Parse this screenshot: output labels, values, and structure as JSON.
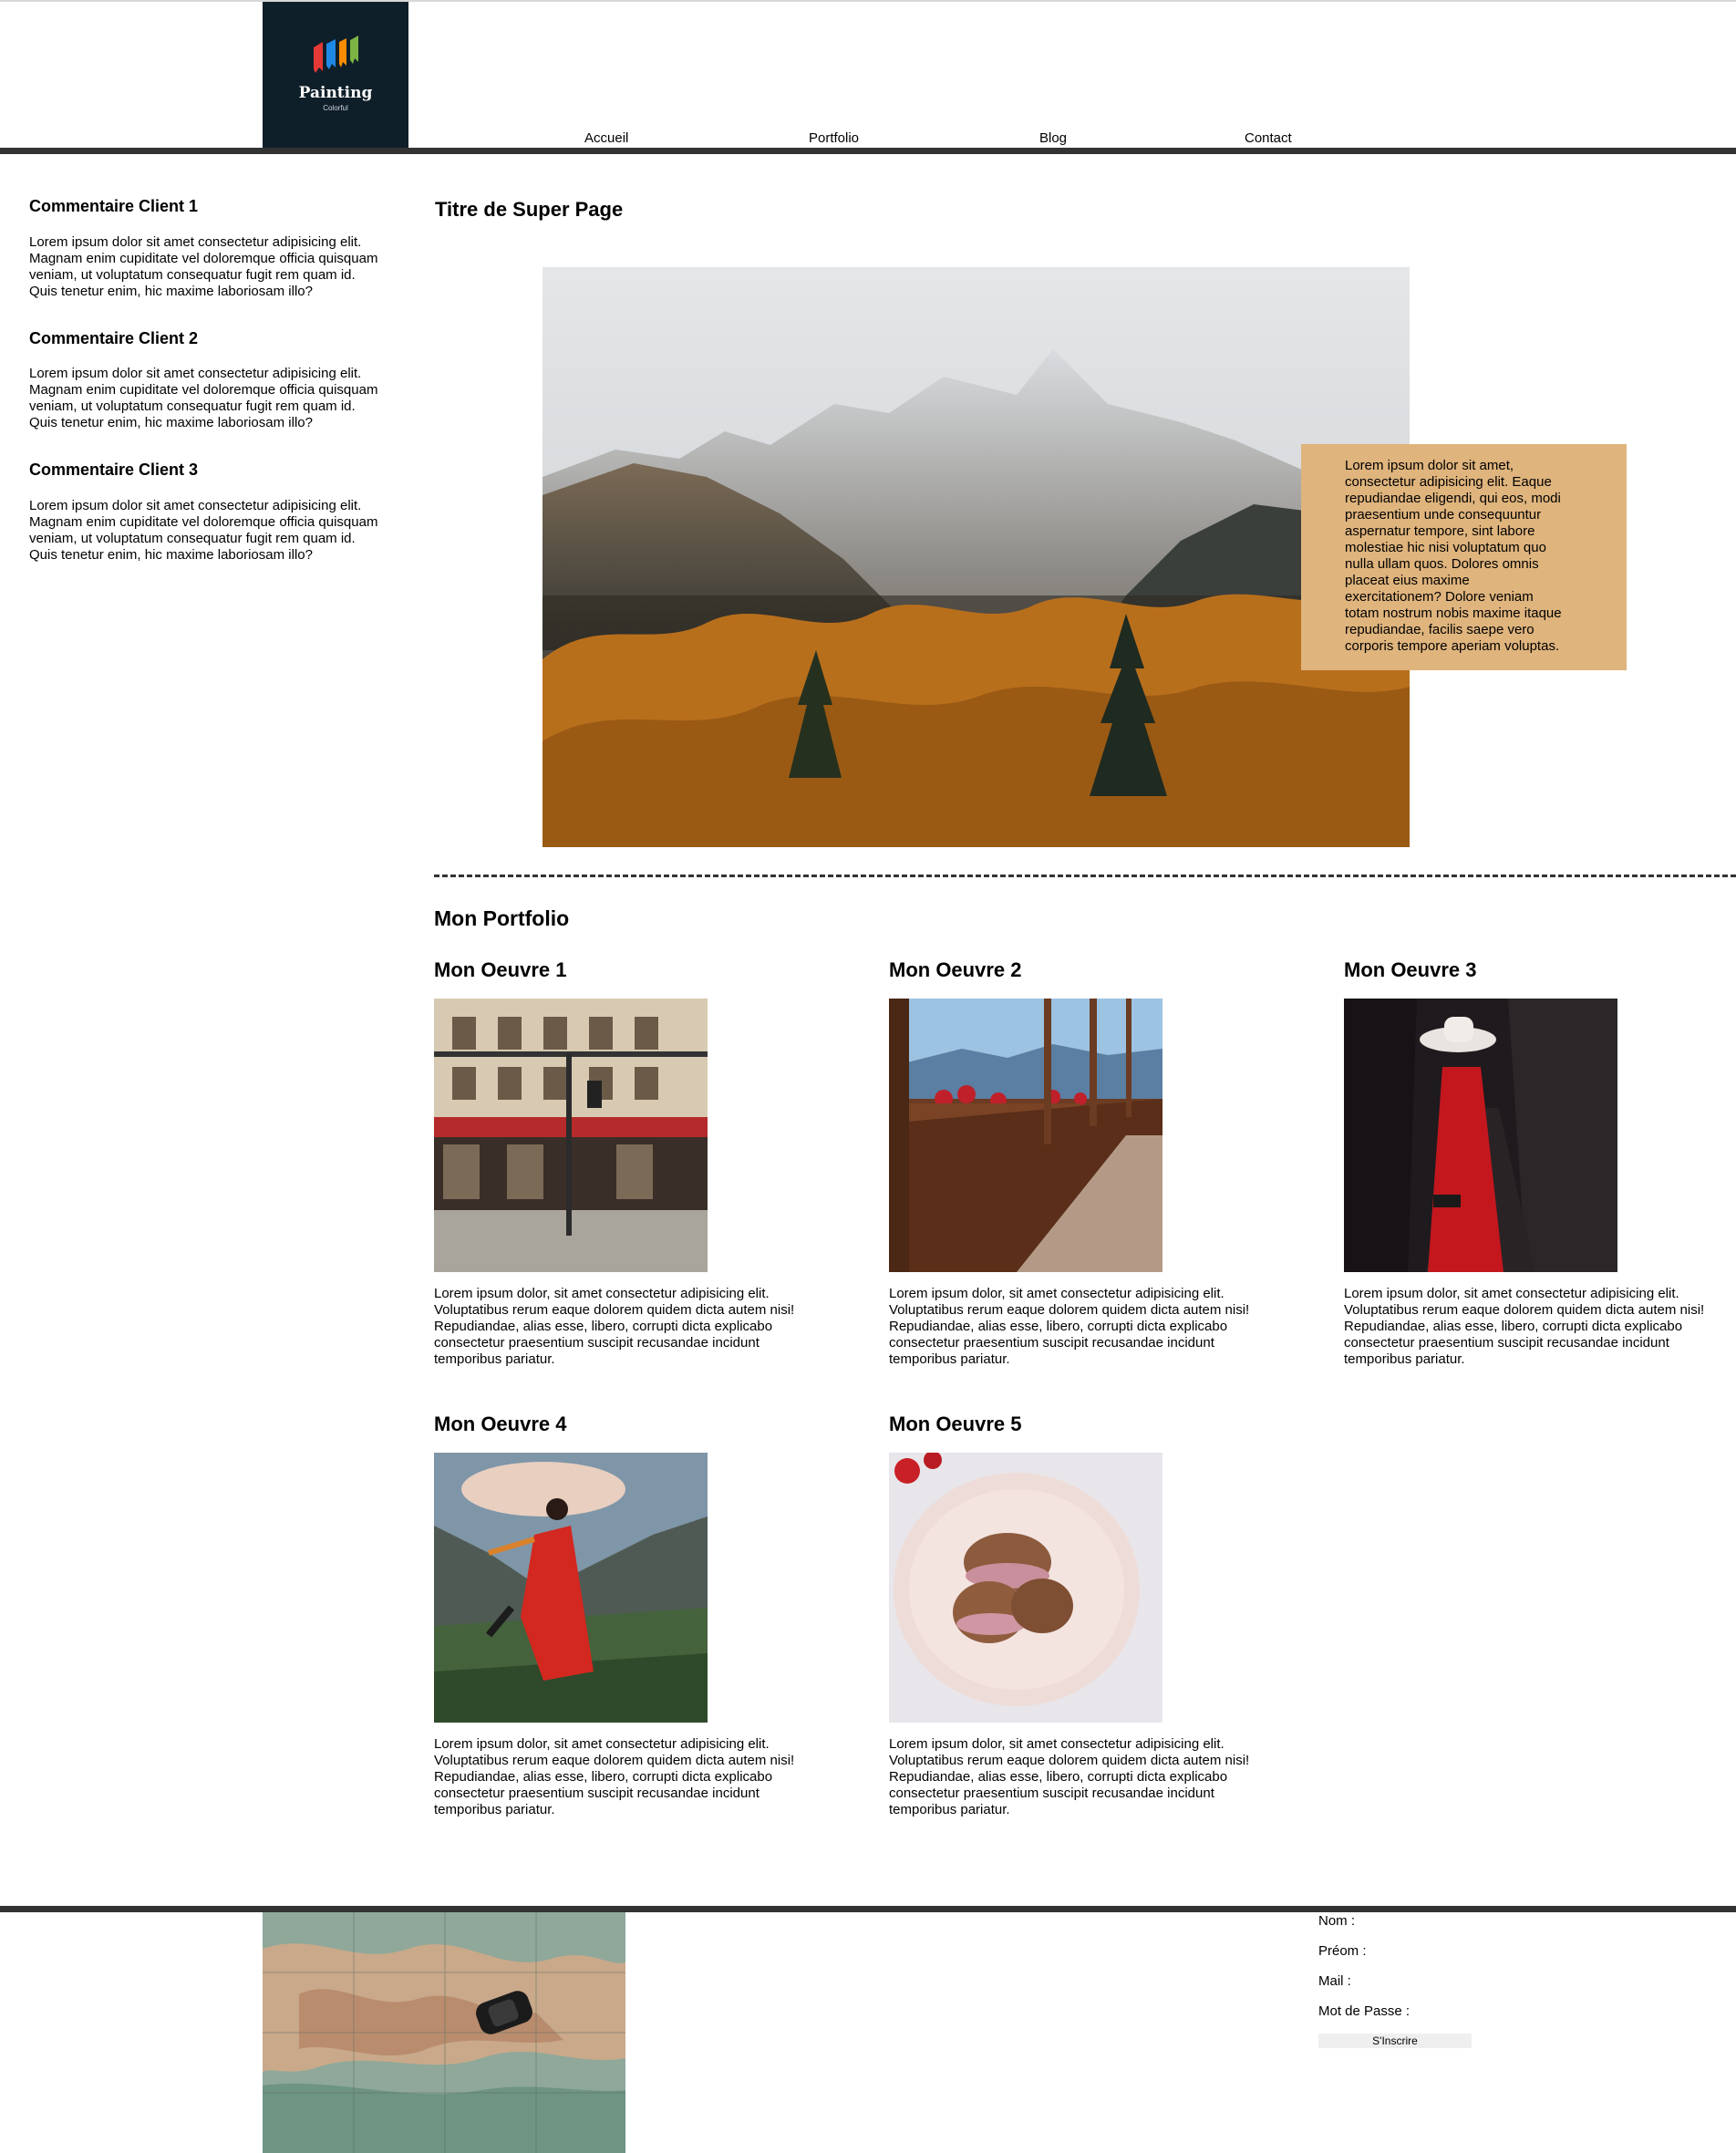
{
  "header": {
    "logo": {
      "title": "Painting",
      "subtitle": "Colorful"
    },
    "nav": [
      "Accueil",
      "Portfolio",
      "Blog",
      "Contact"
    ]
  },
  "sidebar": {
    "comments": [
      {
        "title": "Commentaire Client 1",
        "lines": [
          "Lorem ipsum dolor sit amet consectetur adipisicing elit.",
          "Magnam enim cupiditate vel doloremque officia quisquam",
          "veniam, ut voluptatum consequatur fugit rem quam id.",
          "Quis tenetur enim, hic maxime laboriosam illo?"
        ]
      },
      {
        "title": "Commentaire Client 2",
        "lines": [
          "Lorem ipsum dolor sit amet consectetur adipisicing elit.",
          "Magnam enim cupiditate vel doloremque officia quisquam",
          "veniam, ut voluptatum consequatur fugit rem quam id.",
          "Quis tenetur enim, hic maxime laboriosam illo?"
        ]
      },
      {
        "title": "Commentaire Client 3",
        "lines": [
          "Lorem ipsum dolor sit amet consectetur adipisicing elit.",
          "Magnam enim cupiditate vel doloremque officia quisquam",
          "veniam, ut voluptatum consequatur fugit rem quam id.",
          "Quis tenetur enim, hic maxime laboriosam illo?"
        ]
      }
    ]
  },
  "main": {
    "title": "Titre de Super Page",
    "aside_lines": [
      "Lorem ipsum dolor sit amet,",
      "consectetur adipisicing elit. Eaque",
      "repudiandae eligendi, qui eos, modi",
      "praesentium unde consequuntur",
      "aspernatur tempore, sint labore",
      "molestiae hic nisi voluptatum quo",
      "nulla ullam quos. Dolores omnis",
      "placeat eius maxime",
      "exercitationem? Dolore veniam",
      "totam nostrum nobis maxime itaque",
      "repudiandae, facilis saepe vero",
      "corporis tempore aperiam voluptas."
    ]
  },
  "portfolio": {
    "title": "Mon Portfolio",
    "works": [
      {
        "title": "Mon Oeuvre 1",
        "lines": [
          "Lorem ipsum dolor, sit amet consectetur adipisicing elit.",
          "Voluptatibus rerum eaque dolorem quidem dicta autem nisi!",
          "Repudiandae, alias esse, libero, corrupti dicta explicabo",
          "consectetur praesentium suscipit recusandae incidunt",
          "temporibus pariatur."
        ]
      },
      {
        "title": "Mon Oeuvre 2",
        "lines": [
          "Lorem ipsum dolor, sit amet consectetur adipisicing elit.",
          "Voluptatibus rerum eaque dolorem quidem dicta autem nisi!",
          "Repudiandae, alias esse, libero, corrupti dicta explicabo",
          "consectetur praesentium suscipit recusandae incidunt",
          "temporibus pariatur."
        ]
      },
      {
        "title": "Mon Oeuvre 3",
        "lines": [
          "Lorem ipsum dolor, sit amet consectetur adipisicing elit.",
          "Voluptatibus rerum eaque dolorem quidem dicta autem nisi!",
          "Repudiandae, alias esse, libero, corrupti dicta explicabo",
          "consectetur praesentium suscipit recusandae incidunt",
          "temporibus pariatur."
        ]
      },
      {
        "title": "Mon Oeuvre 4",
        "lines": [
          "Lorem ipsum dolor, sit amet consectetur adipisicing elit.",
          "Voluptatibus rerum eaque dolorem quidem dicta autem nisi!",
          "Repudiandae, alias esse, libero, corrupti dicta explicabo",
          "consectetur praesentium suscipit recusandae incidunt",
          "temporibus pariatur."
        ]
      },
      {
        "title": "Mon Oeuvre 5",
        "lines": [
          "Lorem ipsum dolor, sit amet consectetur adipisicing elit.",
          "Voluptatibus rerum eaque dolorem quidem dicta autem nisi!",
          "Repudiandae, alias esse, libero, corrupti dicta explicabo",
          "consectetur praesentium suscipit recusandae incidunt",
          "temporibus pariatur."
        ]
      }
    ]
  },
  "footer": {
    "form": {
      "nom": "Nom :",
      "prenom": "Préom :",
      "mail": "Mail :",
      "password": "Mot de Passe :",
      "submit": "S'Inscrire"
    }
  },
  "colors": {
    "header_bar": "#333333",
    "logo_bg": "#0f1f2a",
    "aside_bg": "#dfb47d"
  }
}
